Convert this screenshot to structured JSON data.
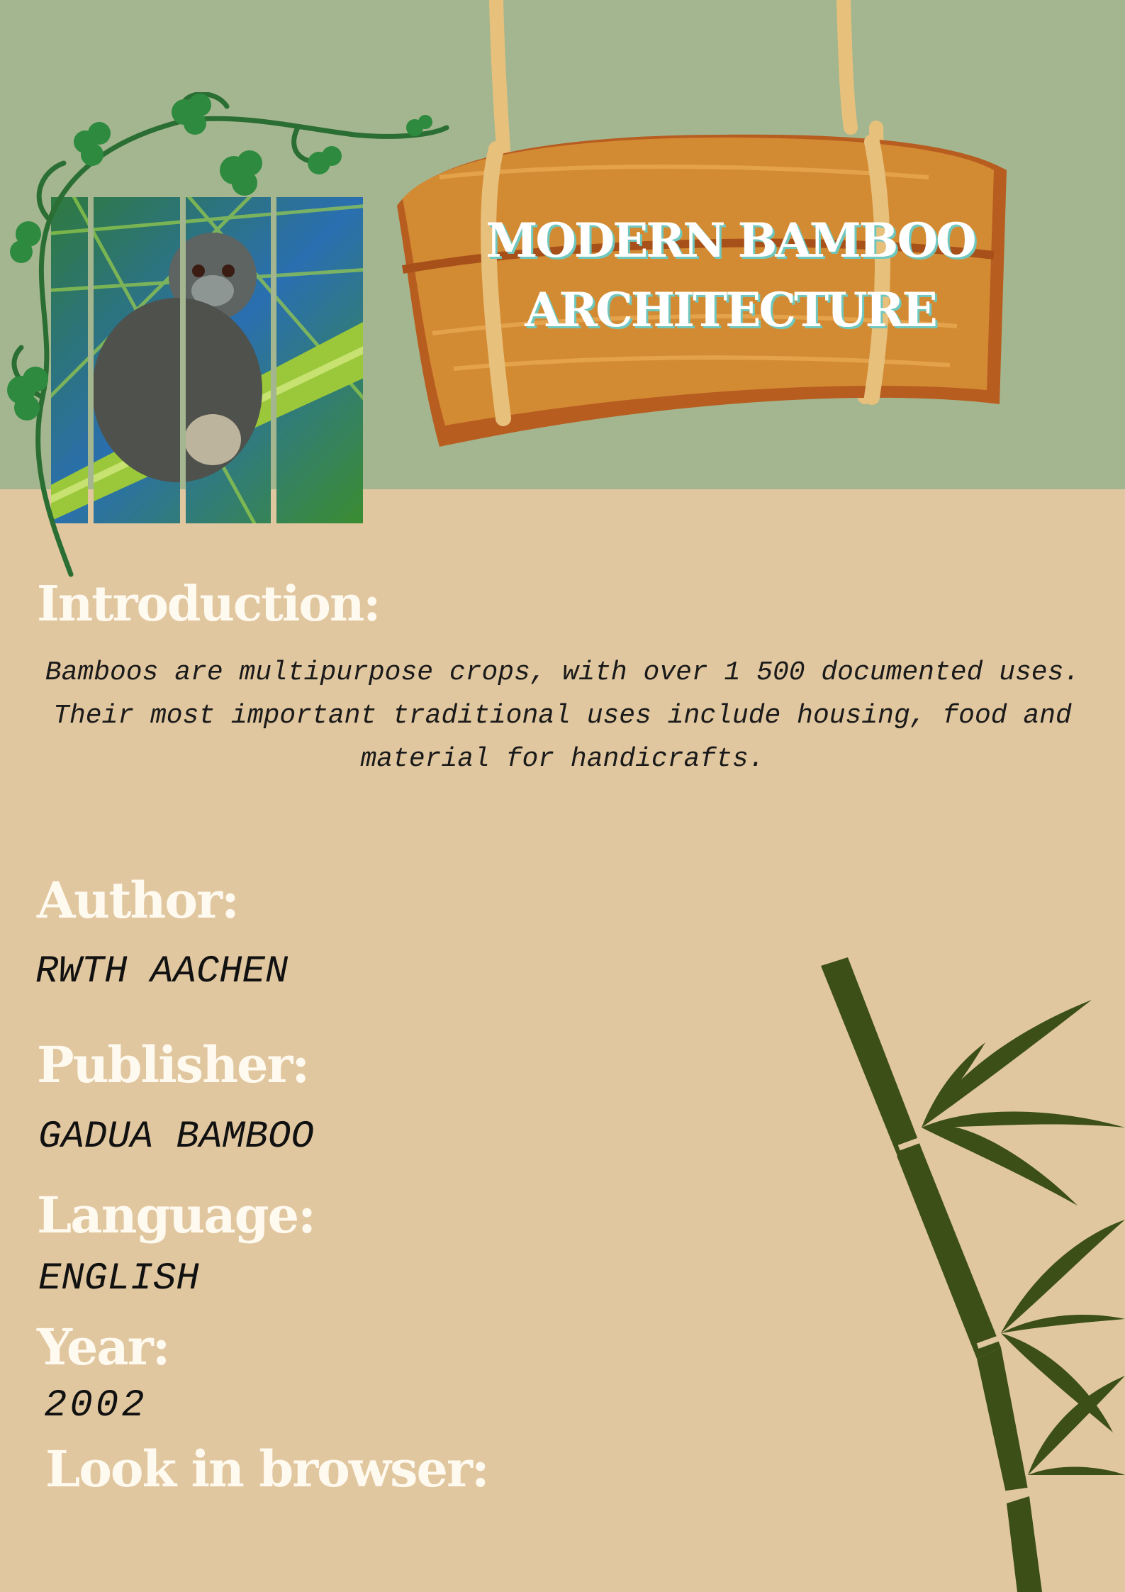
{
  "colors": {
    "top_background": "#a4b68f",
    "bottom_background": "#e1c79f",
    "heading_text": "#fffaf0",
    "bamboo": "#3b4f16",
    "sign_wood": "#d38b33",
    "vine_leaf": "#2d8a3e"
  },
  "sign": {
    "title": "MODERN BAMBOO ARCHITECTURE"
  },
  "intro": {
    "heading": "Introduction:",
    "body": "Bamboos are multipurpose crops, with over 1 500 documented uses. Their most important traditional uses include housing, food and material for handicrafts."
  },
  "author": {
    "heading": "Author:",
    "value": "RWTH AACHEN"
  },
  "publisher": {
    "heading": "Publisher:",
    "value": "GADUA BAMBOO"
  },
  "language": {
    "heading": "Language:",
    "value": "ENGLISH"
  },
  "year": {
    "heading": "Year:",
    "value": "2002"
  },
  "browser": {
    "heading": "Look in browser:"
  },
  "icons": [
    "vine-decoration",
    "lemur-photo",
    "wooden-sign",
    "bamboo-plant"
  ]
}
